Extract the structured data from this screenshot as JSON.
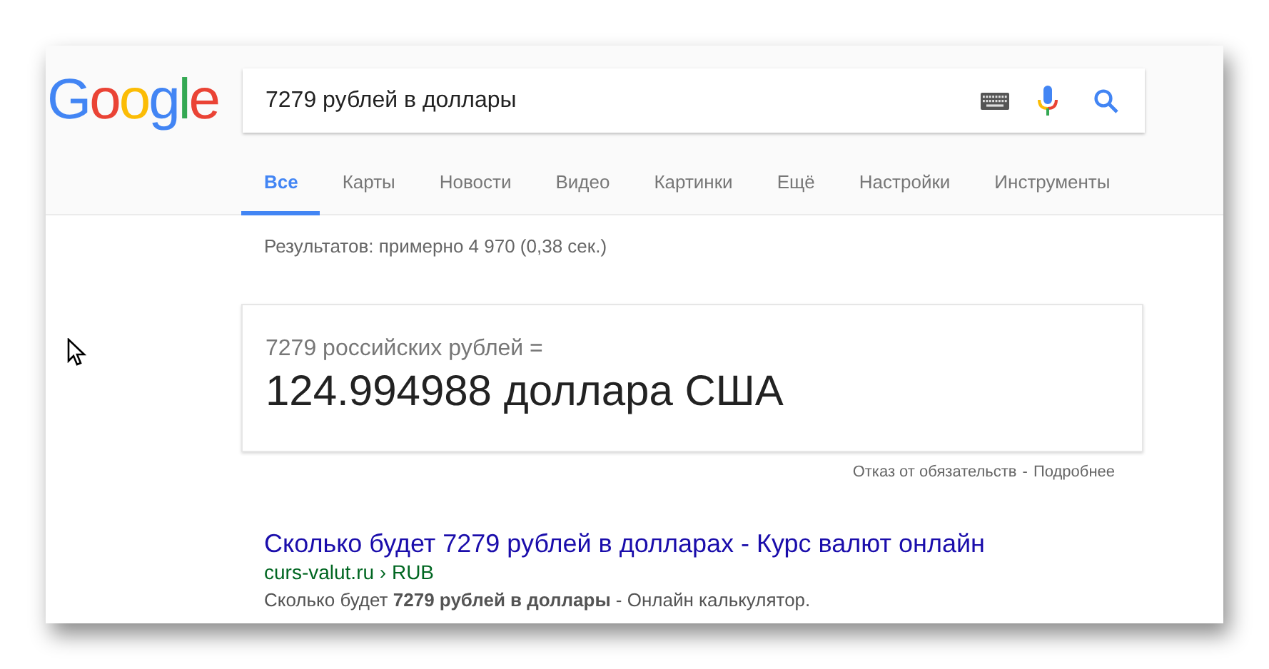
{
  "logo": "Google",
  "search": {
    "value": "7279 рублей в доллары"
  },
  "tabs": [
    {
      "label": "Все",
      "selected": true
    },
    {
      "label": "Карты",
      "selected": false
    },
    {
      "label": "Новости",
      "selected": false
    },
    {
      "label": "Видео",
      "selected": false
    },
    {
      "label": "Картинки",
      "selected": false
    },
    {
      "label": "Ещё",
      "selected": false
    },
    {
      "label": "Настройки",
      "selected": false
    },
    {
      "label": "Инструменты",
      "selected": false
    }
  ],
  "stats": "Результатов: примерно 4 970 (0,38 сек.)",
  "converter": {
    "from": "7279 российских рублей =",
    "result": "124.994988 доллара США"
  },
  "disclaimer": {
    "text": "Отказ от обязательств",
    "separator": "-",
    "link": "Подробнее"
  },
  "results": [
    {
      "title": "Сколько будет 7279 рублей в долларах - Курс валют онлайн",
      "url": "curs-valut.ru › RUB",
      "snippet": "Сколько будет **7279 рублей в доллары** - Онлайн калькулятор."
    }
  ]
}
